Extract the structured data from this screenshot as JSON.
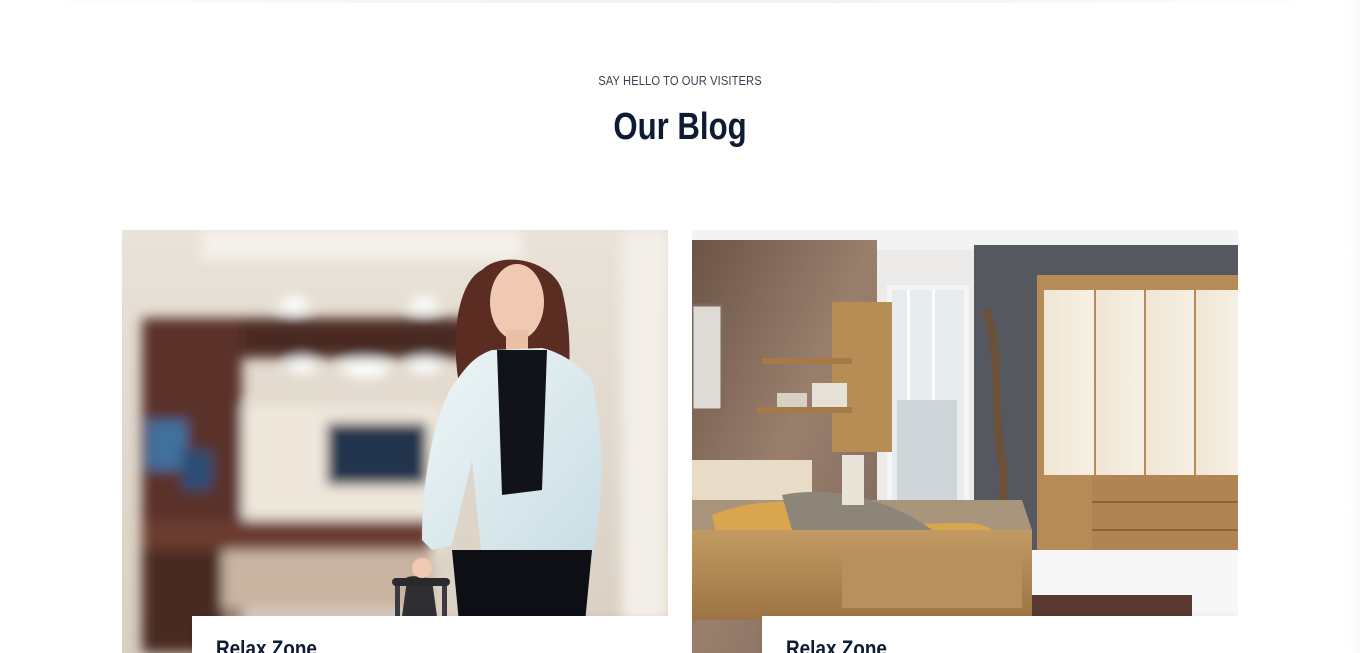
{
  "section": {
    "subtitle": "SAY HELLO TO OUR VISITERS",
    "title": "Our Blog"
  },
  "posts": [
    {
      "image": "woman-with-suitcase-in-hotel-lobby",
      "title": "Relax Zone"
    },
    {
      "image": "modern-bedroom-with-wooden-furniture",
      "title": "Relax Zone"
    }
  ],
  "colors": {
    "heading": "#0d1b33",
    "subtitle": "#3a4250",
    "background": "#ffffff"
  }
}
